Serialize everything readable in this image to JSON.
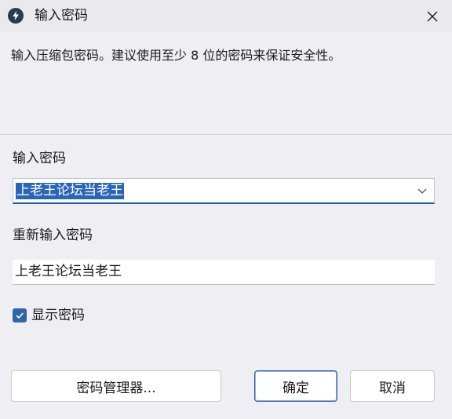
{
  "window": {
    "title": "输入密码",
    "icon": "lightning-app-icon",
    "close_icon": "close-icon"
  },
  "description": "输入压缩包密码。建议使用至少 8 位的密码来保证安全性。",
  "password": {
    "label": "输入密码",
    "value": "上老王论坛当老王"
  },
  "confirm_password": {
    "label": "重新输入密码",
    "value": "上老王论坛当老王"
  },
  "show_password": {
    "label": "显示密码",
    "checked": true
  },
  "buttons": {
    "manager": "密码管理器...",
    "ok": "确定",
    "cancel": "取消"
  },
  "colors": {
    "accent": "#2f64a8",
    "selection": "#2a66b8"
  }
}
